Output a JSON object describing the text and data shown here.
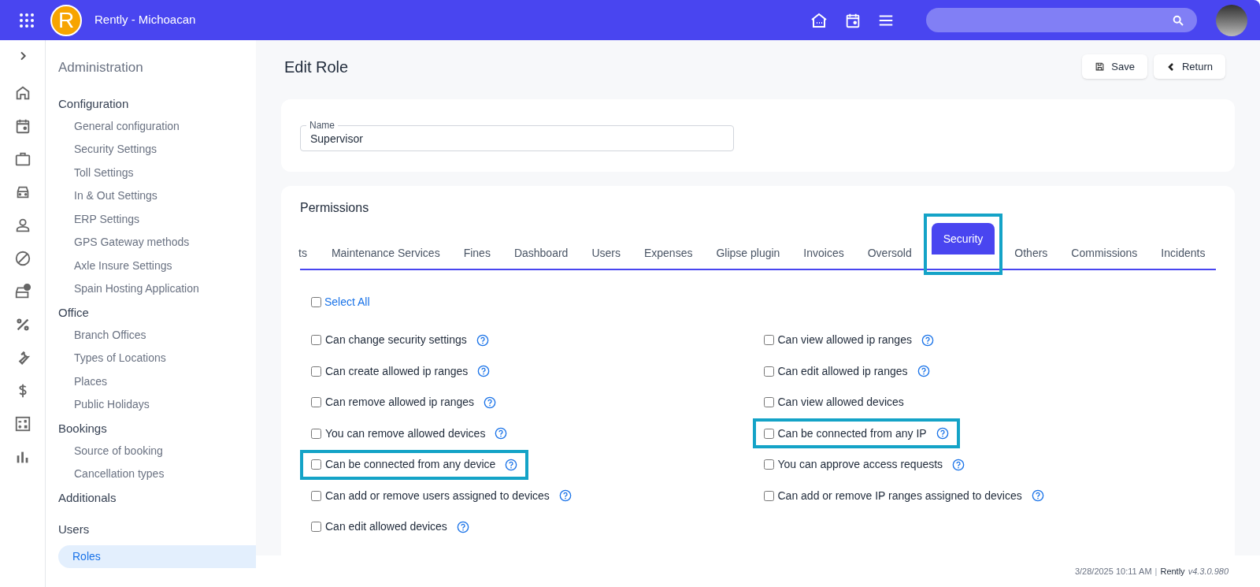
{
  "header": {
    "title": "Rently - Michoacan",
    "logo_letter": "R"
  },
  "sidebar": {
    "heading": "Administration",
    "sections": [
      {
        "label": "Configuration",
        "children": [
          {
            "label": "General configuration",
            "selected": false
          },
          {
            "label": "Security Settings",
            "selected": false
          },
          {
            "label": "Toll Settings",
            "selected": false
          },
          {
            "label": "In & Out Settings",
            "selected": false
          },
          {
            "label": "ERP Settings",
            "selected": false
          },
          {
            "label": "GPS Gateway methods",
            "selected": false
          },
          {
            "label": "Axle Insure Settings",
            "selected": false
          },
          {
            "label": "Spain Hosting Application",
            "selected": false
          }
        ]
      },
      {
        "label": "Office",
        "children": [
          {
            "label": "Branch Offices",
            "selected": false
          },
          {
            "label": "Types of Locations",
            "selected": false
          },
          {
            "label": "Places",
            "selected": false
          },
          {
            "label": "Public Holidays",
            "selected": false
          }
        ]
      },
      {
        "label": "Bookings",
        "children": [
          {
            "label": "Source of booking",
            "selected": false
          },
          {
            "label": "Cancellation types",
            "selected": false
          }
        ]
      },
      {
        "label": "Additionals"
      },
      {
        "label": "Users",
        "children": [
          {
            "label": "Roles",
            "selected": true
          }
        ]
      }
    ]
  },
  "page": {
    "title": "Edit Role",
    "buttons": [
      {
        "kind": "save",
        "label": "Save"
      },
      {
        "kind": "return",
        "label": "Return"
      }
    ]
  },
  "name_field": {
    "label": "Name",
    "value": "Supervisor"
  },
  "permissions": {
    "title": "Permissions",
    "tabs": [
      {
        "label": "ts",
        "selected": false,
        "highlighted": false
      },
      {
        "label": "Maintenance Services",
        "selected": false,
        "highlighted": false
      },
      {
        "label": "Fines",
        "selected": false,
        "highlighted": false
      },
      {
        "label": "Dashboard",
        "selected": false,
        "highlighted": false
      },
      {
        "label": "Users",
        "selected": false,
        "highlighted": false
      },
      {
        "label": "Expenses",
        "selected": false,
        "highlighted": false
      },
      {
        "label": "Glipse plugin",
        "selected": false,
        "highlighted": false
      },
      {
        "label": "Invoices",
        "selected": false,
        "highlighted": false
      },
      {
        "label": "Oversold",
        "selected": false,
        "highlighted": false
      },
      {
        "label": "Security",
        "selected": true,
        "highlighted": true
      },
      {
        "label": "Others",
        "selected": false,
        "highlighted": false
      },
      {
        "label": "Commissions",
        "selected": false,
        "highlighted": false
      },
      {
        "label": "Incidents",
        "selected": false,
        "highlighted": false
      }
    ],
    "select_all": {
      "label": "Select All",
      "checked": false
    },
    "left": [
      {
        "label": "Can change security settings",
        "checked": false,
        "help": true,
        "highlighted": false
      },
      {
        "label": "Can create allowed ip ranges",
        "checked": false,
        "help": true,
        "highlighted": false
      },
      {
        "label": "Can remove allowed ip ranges",
        "checked": false,
        "help": true,
        "highlighted": false
      },
      {
        "label": "You can remove allowed devices",
        "checked": false,
        "help": true,
        "highlighted": false
      },
      {
        "label": "Can be connected from any device",
        "checked": false,
        "help": true,
        "highlighted": true
      },
      {
        "label": "Can add or remove users assigned to devices",
        "checked": false,
        "help": true,
        "highlighted": false
      },
      {
        "label": "Can edit allowed devices",
        "checked": false,
        "help": true,
        "highlighted": false
      }
    ],
    "right": [
      {
        "label": "Can view allowed ip ranges",
        "checked": false,
        "help": true,
        "highlighted": false
      },
      {
        "label": "Can edit allowed ip ranges",
        "checked": false,
        "help": true,
        "highlighted": false
      },
      {
        "label": "Can view allowed devices",
        "checked": false,
        "help": false,
        "highlighted": false
      },
      {
        "label": "Can be connected from any IP",
        "checked": false,
        "help": true,
        "highlighted": true
      },
      {
        "label": "You can approve access requests",
        "checked": false,
        "help": true,
        "highlighted": false
      },
      {
        "label": "Can add or remove IP ranges assigned to devices",
        "checked": false,
        "help": true,
        "highlighted": false
      }
    ]
  },
  "footer": {
    "datetime": "3/28/2025 10:11 AM",
    "separator": "|",
    "brand": "Rently",
    "version": "v4.3.0.980"
  }
}
